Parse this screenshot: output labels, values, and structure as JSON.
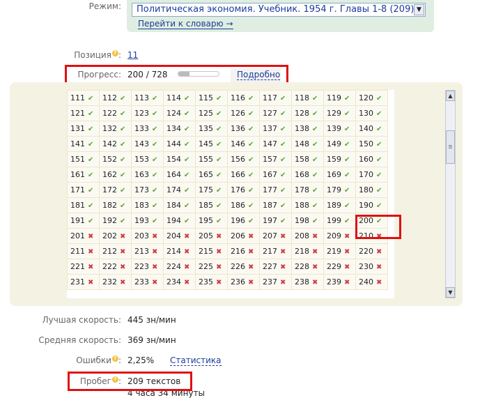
{
  "mode": {
    "label": "Режим:",
    "selected": "Политическая экономия. Учебник. 1954 г. Главы 1-8 (209)",
    "dict_link": "Перейти к словарю →"
  },
  "position": {
    "label": "Позиция",
    "value": "11"
  },
  "progress": {
    "label": "Прогресс:",
    "value": "200 / 728",
    "fraction": 0.275,
    "details_link": "Подробно"
  },
  "hint_glyph": "?",
  "grid": {
    "ok_glyph": "✔",
    "bad_glyph": "✖",
    "rows": [
      [
        [
          "111",
          "ok"
        ],
        [
          "112",
          "ok"
        ],
        [
          "113",
          "ok"
        ],
        [
          "114",
          "ok"
        ],
        [
          "115",
          "ok"
        ],
        [
          "116",
          "ok"
        ],
        [
          "117",
          "ok"
        ],
        [
          "118",
          "ok"
        ],
        [
          "119",
          "ok"
        ],
        [
          "120",
          "ok"
        ]
      ],
      [
        [
          "121",
          "ok"
        ],
        [
          "122",
          "ok"
        ],
        [
          "123",
          "ok"
        ],
        [
          "124",
          "ok"
        ],
        [
          "125",
          "ok"
        ],
        [
          "126",
          "ok"
        ],
        [
          "127",
          "ok"
        ],
        [
          "128",
          "ok"
        ],
        [
          "129",
          "ok"
        ],
        [
          "130",
          "ok"
        ]
      ],
      [
        [
          "131",
          "ok"
        ],
        [
          "132",
          "ok"
        ],
        [
          "133",
          "ok"
        ],
        [
          "134",
          "ok"
        ],
        [
          "135",
          "ok"
        ],
        [
          "136",
          "ok"
        ],
        [
          "137",
          "ok"
        ],
        [
          "138",
          "ok"
        ],
        [
          "139",
          "ok"
        ],
        [
          "140",
          "ok"
        ]
      ],
      [
        [
          "141",
          "ok"
        ],
        [
          "142",
          "ok"
        ],
        [
          "143",
          "ok"
        ],
        [
          "144",
          "ok"
        ],
        [
          "145",
          "ok"
        ],
        [
          "146",
          "ok"
        ],
        [
          "147",
          "ok"
        ],
        [
          "148",
          "ok"
        ],
        [
          "149",
          "ok"
        ],
        [
          "150",
          "ok"
        ]
      ],
      [
        [
          "151",
          "ok"
        ],
        [
          "152",
          "ok"
        ],
        [
          "153",
          "ok"
        ],
        [
          "154",
          "ok"
        ],
        [
          "155",
          "ok"
        ],
        [
          "156",
          "ok"
        ],
        [
          "157",
          "ok"
        ],
        [
          "158",
          "ok"
        ],
        [
          "159",
          "ok"
        ],
        [
          "160",
          "ok"
        ]
      ],
      [
        [
          "161",
          "ok"
        ],
        [
          "162",
          "ok"
        ],
        [
          "163",
          "ok"
        ],
        [
          "164",
          "ok"
        ],
        [
          "165",
          "ok"
        ],
        [
          "166",
          "ok"
        ],
        [
          "167",
          "ok"
        ],
        [
          "168",
          "ok"
        ],
        [
          "169",
          "ok"
        ],
        [
          "170",
          "ok"
        ]
      ],
      [
        [
          "171",
          "ok"
        ],
        [
          "172",
          "ok"
        ],
        [
          "173",
          "ok"
        ],
        [
          "174",
          "ok"
        ],
        [
          "175",
          "ok"
        ],
        [
          "176",
          "ok"
        ],
        [
          "177",
          "ok"
        ],
        [
          "178",
          "ok"
        ],
        [
          "179",
          "ok"
        ],
        [
          "180",
          "ok"
        ]
      ],
      [
        [
          "181",
          "ok"
        ],
        [
          "182",
          "ok"
        ],
        [
          "183",
          "ok"
        ],
        [
          "184",
          "ok"
        ],
        [
          "185",
          "ok"
        ],
        [
          "186",
          "ok"
        ],
        [
          "187",
          "ok"
        ],
        [
          "188",
          "ok"
        ],
        [
          "189",
          "ok"
        ],
        [
          "190",
          "ok"
        ]
      ],
      [
        [
          "191",
          "ok"
        ],
        [
          "192",
          "ok"
        ],
        [
          "193",
          "ok"
        ],
        [
          "194",
          "ok"
        ],
        [
          "195",
          "ok"
        ],
        [
          "196",
          "ok"
        ],
        [
          "197",
          "ok"
        ],
        [
          "198",
          "ok"
        ],
        [
          "199",
          "ok"
        ],
        [
          "200",
          "ok"
        ]
      ],
      [
        [
          "201",
          "bad"
        ],
        [
          "202",
          "bad"
        ],
        [
          "203",
          "bad"
        ],
        [
          "204",
          "bad"
        ],
        [
          "205",
          "bad"
        ],
        [
          "206",
          "bad"
        ],
        [
          "207",
          "bad"
        ],
        [
          "208",
          "bad"
        ],
        [
          "209",
          "bad"
        ],
        [
          "210",
          "bad"
        ]
      ],
      [
        [
          "211",
          "bad"
        ],
        [
          "212",
          "bad"
        ],
        [
          "213",
          "bad"
        ],
        [
          "214",
          "bad"
        ],
        [
          "215",
          "bad"
        ],
        [
          "216",
          "bad"
        ],
        [
          "217",
          "bad"
        ],
        [
          "218",
          "bad"
        ],
        [
          "219",
          "bad"
        ],
        [
          "220",
          "bad"
        ]
      ],
      [
        [
          "221",
          "bad"
        ],
        [
          "222",
          "bad"
        ],
        [
          "223",
          "bad"
        ],
        [
          "224",
          "bad"
        ],
        [
          "225",
          "bad"
        ],
        [
          "226",
          "bad"
        ],
        [
          "227",
          "bad"
        ],
        [
          "228",
          "bad"
        ],
        [
          "229",
          "bad"
        ],
        [
          "230",
          "bad"
        ]
      ],
      [
        [
          "231",
          "bad"
        ],
        [
          "232",
          "bad"
        ],
        [
          "233",
          "bad"
        ],
        [
          "234",
          "bad"
        ],
        [
          "235",
          "bad"
        ],
        [
          "236",
          "bad"
        ],
        [
          "237",
          "bad"
        ],
        [
          "238",
          "bad"
        ],
        [
          "239",
          "bad"
        ],
        [
          "240",
          "bad"
        ]
      ]
    ]
  },
  "stats": {
    "best_speed": {
      "label": "Лучшая скорость:",
      "value": "445 зн/мин"
    },
    "avg_speed": {
      "label": "Средняя скорость:",
      "value": "369 зн/мин"
    },
    "errors": {
      "label": "Ошибки",
      "value": "2,25%",
      "link": "Статистика"
    },
    "mileage": {
      "label": "Пробег",
      "value": "209 текстов",
      "time": "4 часа 34 минуты"
    }
  },
  "colors": {
    "highlight": "#e01010",
    "ok": "#58a832",
    "bad": "#d23b3b",
    "panel": "#f4f2e3",
    "link": "#1a3b9c"
  }
}
